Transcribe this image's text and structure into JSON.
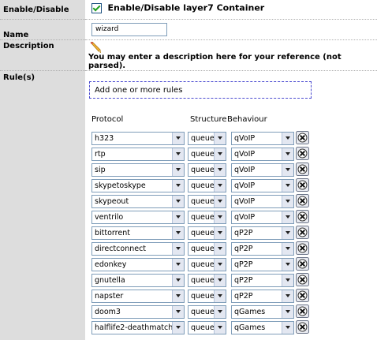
{
  "fields": {
    "enable": {
      "label": "Enable/Disable",
      "checkbox_text": "Enable/Disable layer7 Container",
      "checked": true
    },
    "name": {
      "label": "Name",
      "value": "wizard"
    },
    "description": {
      "label": "Description",
      "note": "You may enter a description here for your reference (not parsed)."
    },
    "rules": {
      "label": "Rule(s)",
      "add_text": "Add one or more rules",
      "headers": {
        "protocol": "Protocol",
        "structure": "Structure",
        "behaviour": "Behaviour"
      },
      "items": [
        {
          "protocol": "h323",
          "structure": "queue",
          "behaviour": "qVoIP"
        },
        {
          "protocol": "rtp",
          "structure": "queue",
          "behaviour": "qVoIP"
        },
        {
          "protocol": "sip",
          "structure": "queue",
          "behaviour": "qVoIP"
        },
        {
          "protocol": "skypetoskype",
          "structure": "queue",
          "behaviour": "qVoIP"
        },
        {
          "protocol": "skypeout",
          "structure": "queue",
          "behaviour": "qVoIP"
        },
        {
          "protocol": "ventrilo",
          "structure": "queue",
          "behaviour": "qVoIP"
        },
        {
          "protocol": "bittorrent",
          "structure": "queue",
          "behaviour": "qP2P"
        },
        {
          "protocol": "directconnect",
          "structure": "queue",
          "behaviour": "qP2P"
        },
        {
          "protocol": "edonkey",
          "structure": "queue",
          "behaviour": "qP2P"
        },
        {
          "protocol": "gnutella",
          "structure": "queue",
          "behaviour": "qP2P"
        },
        {
          "protocol": "napster",
          "structure": "queue",
          "behaviour": "qP2P"
        },
        {
          "protocol": "doom3",
          "structure": "queue",
          "behaviour": "qGames"
        },
        {
          "protocol": "halflife2-deathmatch",
          "structure": "queue",
          "behaviour": "qGames"
        }
      ]
    }
  },
  "icons": {
    "pencil": "pencil-icon",
    "delete": "delete-rule-icon",
    "dropdown": "chevron-down-icon"
  },
  "colors": {
    "label_bg": "#dddddd",
    "input_border": "#7f9db9",
    "add_box_border": "#4a4ad0"
  }
}
